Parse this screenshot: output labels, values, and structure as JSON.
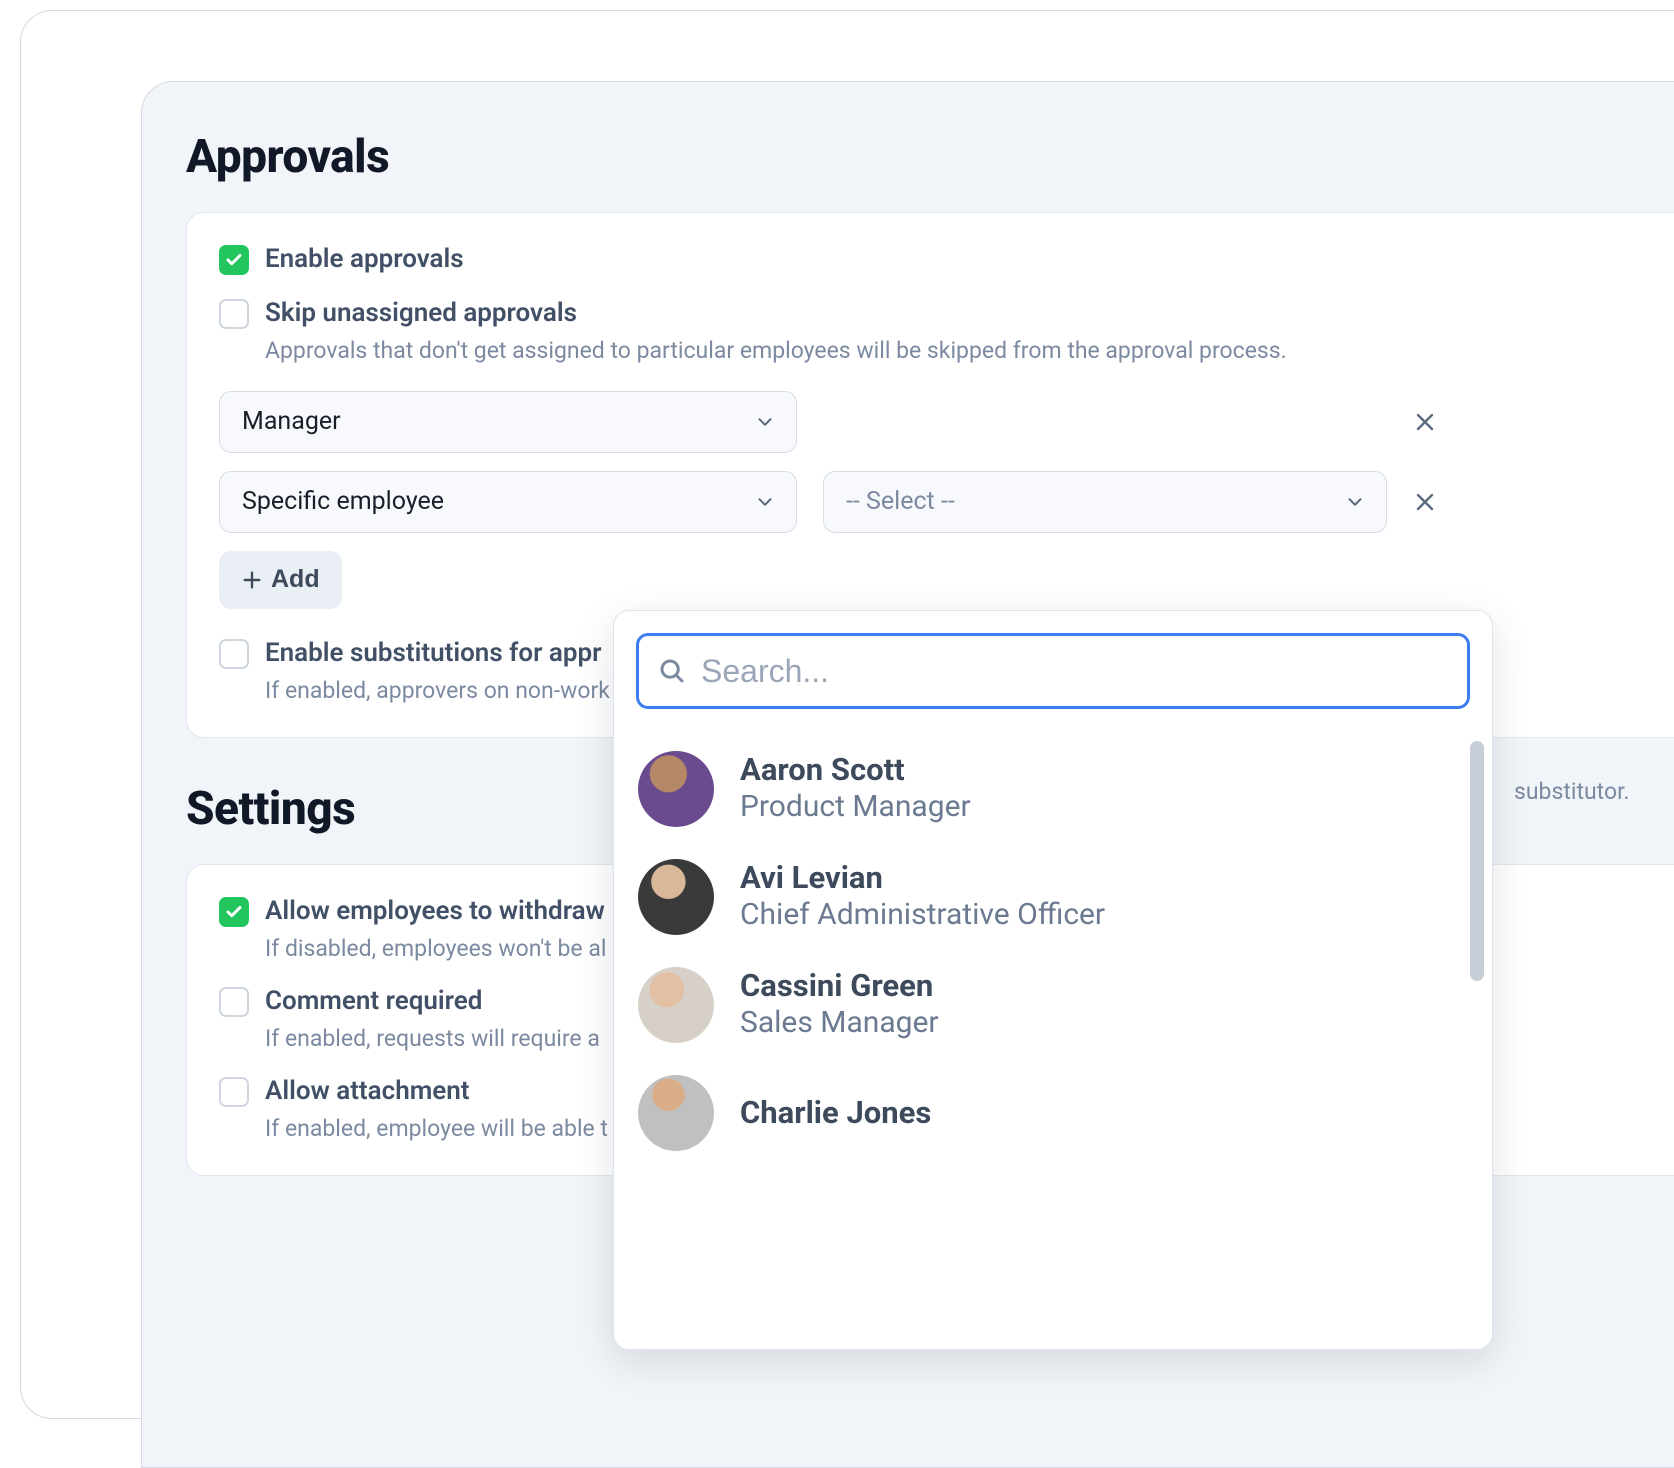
{
  "sections": {
    "approvals": {
      "title": "Approvals",
      "enable_label": "Enable approvals",
      "skip_label": "Skip unassigned approvals",
      "skip_desc": "Approvals that don't get assigned to particular employees will be skipped from the approval process.",
      "select1": "Manager",
      "select2": "Specific employee",
      "select3_placeholder": "-- Select --",
      "add_label": "Add",
      "substitutions_label": "Enable substitutions for appr",
      "substitutions_desc": "If enabled, approvers on non-work",
      "substitutions_trail": "substitutor."
    },
    "settings": {
      "title": "Settings",
      "withdraw_label": "Allow employees to withdraw",
      "withdraw_desc": "If disabled, employees won't be al",
      "comment_label": "Comment required",
      "comment_desc": "If enabled, requests will require a",
      "attach_label": "Allow attachment",
      "attach_desc": "If enabled, employee will be able t"
    }
  },
  "dropdown": {
    "search_placeholder": "Search...",
    "employees": [
      {
        "name": "Aaron Scott",
        "role": "Product Manager"
      },
      {
        "name": "Avi Levian",
        "role": "Chief Administrative Officer"
      },
      {
        "name": "Cassini Green",
        "role": "Sales Manager"
      },
      {
        "name": "Charlie Jones",
        "role": ""
      }
    ]
  }
}
